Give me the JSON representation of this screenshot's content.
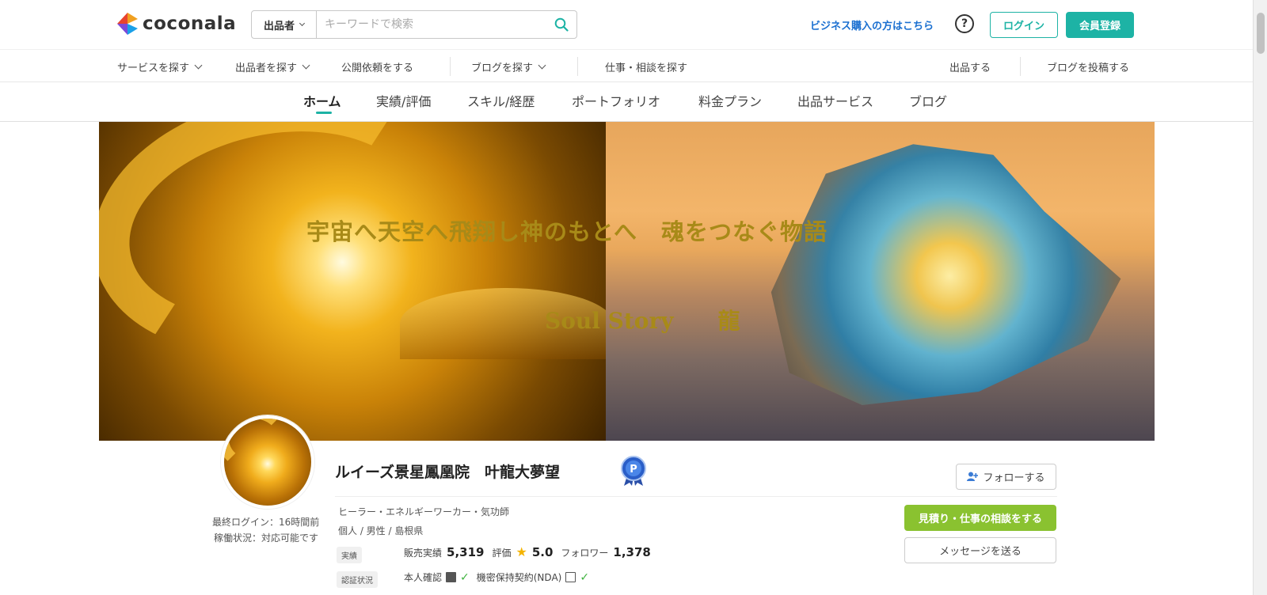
{
  "header": {
    "logo_text": "coconala",
    "search_scope": "出品者",
    "search_placeholder": "キーワードで検索",
    "business_link": "ビジネス購入の方はこちら",
    "help": "?",
    "login": "ログイン",
    "signup": "会員登録"
  },
  "subnav": {
    "left": [
      "サービスを探す",
      "出品者を探す",
      "公開依頼をする",
      "ブログを探す",
      "仕事・相談を探す"
    ],
    "right": [
      "出品する",
      "ブログを投稿する"
    ]
  },
  "tabs": [
    "ホーム",
    "実績/評価",
    "スキル/経歴",
    "ポートフォリオ",
    "料金プラン",
    "出品サービス",
    "ブログ"
  ],
  "active_tab": "ホーム",
  "banner": {
    "line1": "宇宙へ天空へ飛翔し神のもとへ　魂をつなぐ物語",
    "line2": "Soul Story　　龍"
  },
  "profile": {
    "name": "ルイーズ景星鳳凰院　叶龍大夢望",
    "last_login": "最終ログイン：16時間前",
    "status": "稼働状況：対応可能です",
    "occupation": "ヒーラー・エネルギーワーカー・気功師",
    "meta": "個人 /  男性 /  島根県",
    "tag_results": "実績",
    "sales_label": "販売実績",
    "sales_value": "5,319",
    "rating_label": "評価",
    "rating_value": "5.0",
    "follower_label": "フォロワー",
    "follower_value": "1,378",
    "tag_verify": "認証状況",
    "verify_identity": "本人確認",
    "verify_nda": "機密保持契約(NDA)",
    "follow_btn": "フォローする",
    "consult_btn": "見積り・仕事の相談をする",
    "message_btn": "メッセージを送る"
  },
  "colors": {
    "brand": "#1db3a5",
    "consult": "#8ac230",
    "link": "#1a6fd0",
    "banner_text": "#a88a18"
  }
}
